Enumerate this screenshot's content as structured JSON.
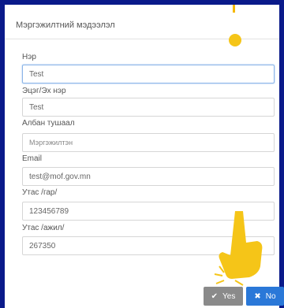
{
  "dialog": {
    "title": "Мэргэжилтний мэдээлэл"
  },
  "form": {
    "fields": [
      {
        "label": "Нэр",
        "value": "Test"
      },
      {
        "label": "Эцэг/Эх нэр",
        "value": "Test"
      },
      {
        "label": "Албан тушаал",
        "value": "Мэргэжилтэн"
      },
      {
        "label": "Email",
        "value": "test@mof.gov.mn"
      },
      {
        "label": "Утас /гар/",
        "value": "123456789"
      },
      {
        "label": "Утас /ажил/",
        "value": "267350"
      }
    ]
  },
  "actions": {
    "yes_label": "Yes",
    "no_label": "No"
  },
  "icons": {
    "yes": "check-icon",
    "no": "close-icon",
    "pointer": "pointing-hand-icon"
  },
  "colors": {
    "yes_button": "#8a8a8a",
    "no_button": "#2a78d8",
    "highlight": "#f5c518",
    "background": "#0a1a8a"
  }
}
